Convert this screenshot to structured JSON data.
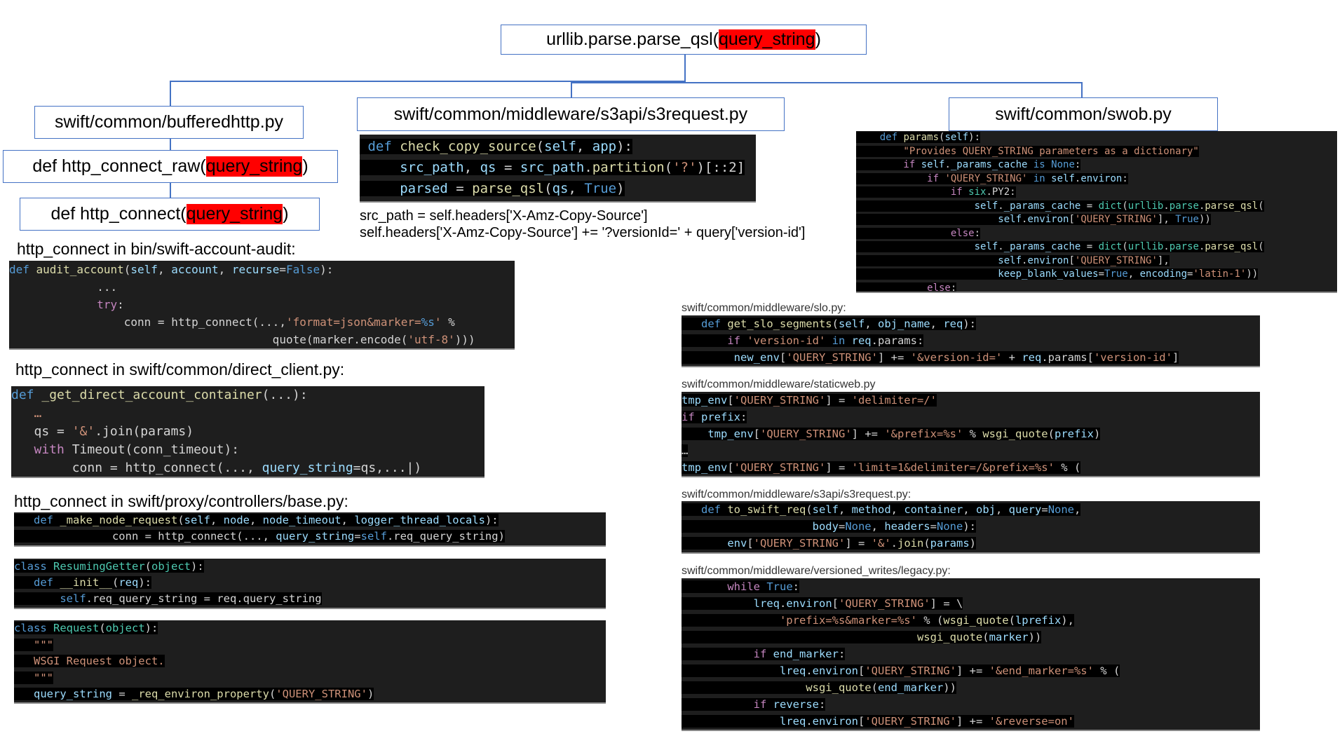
{
  "root": {
    "prefix": "urllib.parse.parse_qsl(",
    "arg": "query_string",
    "suffix": ")"
  },
  "buffered": {
    "title": "swift/common/bufferedhttp.py",
    "raw": {
      "prefix": "def http_connect_raw(",
      "arg": "query_string",
      "suffix": ")"
    },
    "conn": {
      "prefix": "def http_connect(",
      "arg": "query_string",
      "suffix": ")"
    }
  },
  "s3request": {
    "title": "swift/common/middleware/s3api/s3request.py",
    "note1": "src_path = self.headers['X-Amz-Copy-Source']",
    "note2": "self.headers['X-Amz-Copy-Source'] += '?versionId=' + query['version-id']"
  },
  "swob": {
    "title": "swift/common/swob.py"
  },
  "labels": {
    "audit": "http_connect  in bin/swift-account-audit:",
    "direct": "http_connect  in swift/common/direct_client.py:",
    "base": "http_connect in swift/proxy/controllers/base.py:",
    "slo": "swift/common/middleware/slo.py:",
    "staticweb": "swift/common/middleware/staticweb.py",
    "s3req": "swift/common/middleware/s3api/s3request.py:",
    "legacy": "swift/common/middleware/versioned_writes/legacy.py:"
  },
  "code": {
    "s3check": [
      [
        [
          " def ",
          "k"
        ],
        [
          "check_copy_source",
          "f"
        ],
        [
          "(",
          "p"
        ],
        [
          "self",
          "v"
        ],
        [
          ", ",
          "p"
        ],
        [
          "app",
          "v"
        ],
        [
          "):",
          "p"
        ]
      ],
      [
        [
          "     src_path",
          "v"
        ],
        [
          ", ",
          "p"
        ],
        [
          "qs",
          "v"
        ],
        [
          " = ",
          "p"
        ],
        [
          "src_path",
          "v"
        ],
        [
          ".",
          "p"
        ],
        [
          "partition",
          "f"
        ],
        [
          "(",
          "p"
        ],
        [
          "'?'",
          "s"
        ],
        [
          ")[::2]",
          "p"
        ]
      ],
      [
        [
          "     parsed",
          "v"
        ],
        [
          " = ",
          "p"
        ],
        [
          "parse_qsl",
          "f"
        ],
        [
          "(",
          "p"
        ],
        [
          "qs",
          "v"
        ],
        [
          ", ",
          "p"
        ],
        [
          "True",
          "k"
        ],
        [
          ")",
          "p"
        ]
      ]
    ],
    "swob": [
      [
        [
          "    def ",
          "k"
        ],
        [
          "params",
          "f"
        ],
        [
          "(",
          "p"
        ],
        [
          "self",
          "v"
        ],
        [
          "):",
          "p"
        ]
      ],
      [
        [
          "        \"Provides QUERY_STRING parameters as a dictionary\"",
          "s"
        ]
      ],
      [
        [
          "        if ",
          "c"
        ],
        [
          "self",
          "v"
        ],
        [
          ".",
          "p"
        ],
        [
          "_params_cache",
          "v"
        ],
        [
          " is ",
          "k"
        ],
        [
          "None",
          "k"
        ],
        [
          ":",
          "p"
        ]
      ],
      [
        [
          "            if ",
          "c"
        ],
        [
          "'QUERY_STRING'",
          "s"
        ],
        [
          " in ",
          "k"
        ],
        [
          "self",
          "v"
        ],
        [
          ".",
          "p"
        ],
        [
          "environ",
          "v"
        ],
        [
          ":",
          "p"
        ]
      ],
      [
        [
          "                if ",
          "c"
        ],
        [
          "six",
          "t"
        ],
        [
          ".PY2:",
          "p"
        ]
      ],
      [
        [
          "                    self",
          "v"
        ],
        [
          ".",
          "p"
        ],
        [
          "_params_cache",
          "v"
        ],
        [
          " = ",
          "p"
        ],
        [
          "dict",
          "t"
        ],
        [
          "(",
          "p"
        ],
        [
          "urllib",
          "t"
        ],
        [
          ".",
          "p"
        ],
        [
          "parse",
          "t"
        ],
        [
          ".",
          "p"
        ],
        [
          "parse_qsl",
          "f"
        ],
        [
          "(",
          "p"
        ]
      ],
      [
        [
          "                        self",
          "v"
        ],
        [
          ".",
          "p"
        ],
        [
          "environ",
          "v"
        ],
        [
          "[",
          "p"
        ],
        [
          "'QUERY_STRING'",
          "s"
        ],
        [
          "], ",
          "p"
        ],
        [
          "True",
          "k"
        ],
        [
          "))",
          "p"
        ]
      ],
      [
        [
          "                else",
          "c"
        ],
        [
          ":",
          "p"
        ]
      ],
      [
        [
          "                    self",
          "v"
        ],
        [
          ".",
          "p"
        ],
        [
          "_params_cache",
          "v"
        ],
        [
          " = ",
          "p"
        ],
        [
          "dict",
          "t"
        ],
        [
          "(",
          "p"
        ],
        [
          "urllib",
          "t"
        ],
        [
          ".",
          "p"
        ],
        [
          "parse",
          "t"
        ],
        [
          ".",
          "p"
        ],
        [
          "parse_qsl",
          "f"
        ],
        [
          "(",
          "p"
        ]
      ],
      [
        [
          "                        self",
          "v"
        ],
        [
          ".",
          "p"
        ],
        [
          "environ",
          "v"
        ],
        [
          "[",
          "p"
        ],
        [
          "'QUERY_STRING'",
          "s"
        ],
        [
          "],",
          "p"
        ]
      ],
      [
        [
          "                        keep_blank_values",
          "v"
        ],
        [
          "=",
          "p"
        ],
        [
          "True",
          "k"
        ],
        [
          ", ",
          "p"
        ],
        [
          "encoding",
          "v"
        ],
        [
          "=",
          "p"
        ],
        [
          "'latin-1'",
          "s"
        ],
        [
          "))",
          "p"
        ]
      ],
      [
        [
          "            else",
          "c"
        ],
        [
          ":",
          "p"
        ]
      ]
    ],
    "audit": [
      [
        [
          "def ",
          "k"
        ],
        [
          "audit_account",
          "f"
        ],
        [
          "(",
          "p"
        ],
        [
          "self",
          "v"
        ],
        [
          ", ",
          "p"
        ],
        [
          "account",
          "v"
        ],
        [
          ", ",
          "p"
        ],
        [
          "recurse",
          "v"
        ],
        [
          "=",
          "p"
        ],
        [
          "False",
          "k"
        ],
        [
          "):",
          "p"
        ]
      ],
      [
        [
          "             ...",
          "p"
        ]
      ],
      [
        [
          "             try",
          "c"
        ],
        [
          ":",
          "p"
        ]
      ],
      [
        [
          "                 conn = http_connect(...,",
          "p"
        ],
        [
          "'format=json&marker=",
          "s"
        ],
        [
          "%s",
          "k"
        ],
        [
          "'",
          "s"
        ],
        [
          " %",
          "p"
        ]
      ],
      [
        [
          "                                       quote(marker.encode(",
          "p"
        ],
        [
          "'utf-8'",
          "s"
        ],
        [
          ")))",
          "p"
        ]
      ]
    ],
    "direct": [
      [
        [
          "def ",
          "k"
        ],
        [
          "_get_direct_account_container",
          "f"
        ],
        [
          "(...):",
          "p"
        ]
      ],
      [
        [
          "   …",
          "s"
        ]
      ],
      [
        [
          "   qs = ",
          "p"
        ],
        [
          "'&'",
          "s"
        ],
        [
          ".join(params)",
          "p"
        ]
      ],
      [
        [
          "   with ",
          "c"
        ],
        [
          "Timeout(conn_timeout):",
          "p"
        ]
      ],
      [
        [
          "        conn = http_connect(..., ",
          "p"
        ],
        [
          "query_string",
          "v"
        ],
        [
          "=qs,...|)",
          "p"
        ]
      ]
    ],
    "base1": [
      [
        [
          "   def ",
          "k"
        ],
        [
          "_make_node_request",
          "f"
        ],
        [
          "(",
          "p"
        ],
        [
          "self",
          "v"
        ],
        [
          ", ",
          "p"
        ],
        [
          "node",
          "v"
        ],
        [
          ", ",
          "p"
        ],
        [
          "node_timeout",
          "v"
        ],
        [
          ", ",
          "p"
        ],
        [
          "logger_thread_locals",
          "v"
        ],
        [
          "):",
          "p"
        ]
      ],
      [
        [
          "               conn = http_connect(..., ",
          "p"
        ],
        [
          "query_string",
          "v"
        ],
        [
          "=",
          "p"
        ],
        [
          "self",
          "k"
        ],
        [
          ".req_query_string)",
          "p"
        ]
      ]
    ],
    "base2": [
      [
        [
          "class ",
          "k"
        ],
        [
          "ResumingGetter",
          "t"
        ],
        [
          "(",
          "p"
        ],
        [
          "object",
          "t"
        ],
        [
          "):",
          "p"
        ]
      ],
      [
        [
          "   def ",
          "k"
        ],
        [
          "__init__",
          "f"
        ],
        [
          "(",
          "p"
        ],
        [
          "req",
          "v"
        ],
        [
          "):",
          "p"
        ]
      ],
      [
        [
          "       self",
          "k"
        ],
        [
          ".req_query_string = req.query_string",
          "p"
        ]
      ]
    ],
    "base3": [
      [
        [
          "class ",
          "k"
        ],
        [
          "Request",
          "t"
        ],
        [
          "(",
          "p"
        ],
        [
          "object",
          "t"
        ],
        [
          "):",
          "p"
        ]
      ],
      [
        [
          "   \"\"\"",
          "s"
        ]
      ],
      [
        [
          "   WSGI Request object.",
          "s"
        ]
      ],
      [
        [
          "   \"\"\"",
          "s"
        ]
      ],
      [
        [
          "   query_string",
          "v"
        ],
        [
          " = ",
          "p"
        ],
        [
          "_req_environ_property",
          "f"
        ],
        [
          "(",
          "p"
        ],
        [
          "'QUERY_STRING'",
          "s"
        ],
        [
          ")",
          "p"
        ]
      ]
    ],
    "slo": [
      [
        [
          "   def ",
          "k"
        ],
        [
          "get_slo_segments",
          "f"
        ],
        [
          "(",
          "p"
        ],
        [
          "self",
          "v"
        ],
        [
          ", ",
          "p"
        ],
        [
          "obj_name",
          "v"
        ],
        [
          ", ",
          "p"
        ],
        [
          "req",
          "v"
        ],
        [
          "):",
          "p"
        ]
      ],
      [
        [
          "       if ",
          "c"
        ],
        [
          "'version-id'",
          "s"
        ],
        [
          " in ",
          "k"
        ],
        [
          "req",
          "v"
        ],
        [
          ".params:",
          "p"
        ]
      ],
      [
        [
          "        new_env",
          "v"
        ],
        [
          "[",
          "p"
        ],
        [
          "'QUERY_STRING'",
          "s"
        ],
        [
          "] += ",
          "p"
        ],
        [
          "'&version-id='",
          "s"
        ],
        [
          " + ",
          "p"
        ],
        [
          "req",
          "v"
        ],
        [
          ".params[",
          "p"
        ],
        [
          "'version-id'",
          "s"
        ],
        [
          "]",
          "p"
        ]
      ]
    ],
    "staticweb": [
      [
        [
          "tmp_env",
          "v"
        ],
        [
          "[",
          "p"
        ],
        [
          "'QUERY_STRING'",
          "s"
        ],
        [
          "] = ",
          "p"
        ],
        [
          "'delimiter=/'",
          "s"
        ]
      ],
      [
        [
          "if ",
          "c"
        ],
        [
          "prefix",
          "v"
        ],
        [
          ":",
          "p"
        ]
      ],
      [
        [
          "    tmp_env",
          "v"
        ],
        [
          "[",
          "p"
        ],
        [
          "'QUERY_STRING'",
          "s"
        ],
        [
          "] += ",
          "p"
        ],
        [
          "'&prefix=%s'",
          "s"
        ],
        [
          " % ",
          "p"
        ],
        [
          "wsgi_quote",
          "f"
        ],
        [
          "(",
          "p"
        ],
        [
          "prefix",
          "v"
        ],
        [
          ")",
          "p"
        ]
      ],
      [
        [
          "…",
          "p"
        ]
      ],
      [
        [
          "tmp_env",
          "v"
        ],
        [
          "[",
          "p"
        ],
        [
          "'QUERY_STRING'",
          "s"
        ],
        [
          "] = ",
          "p"
        ],
        [
          "'limit=1&delimiter=/&prefix=%s'",
          "s"
        ],
        [
          " % (",
          "p"
        ]
      ]
    ],
    "s3req": [
      [
        [
          "   def ",
          "k"
        ],
        [
          "to_swift_req",
          "f"
        ],
        [
          "(",
          "p"
        ],
        [
          "self",
          "v"
        ],
        [
          ", ",
          "p"
        ],
        [
          "method",
          "v"
        ],
        [
          ", ",
          "p"
        ],
        [
          "container",
          "v"
        ],
        [
          ", ",
          "p"
        ],
        [
          "obj",
          "v"
        ],
        [
          ", ",
          "p"
        ],
        [
          "query",
          "v"
        ],
        [
          "=",
          "p"
        ],
        [
          "None",
          "k"
        ],
        [
          ",",
          "p"
        ]
      ],
      [
        [
          "                    body",
          "v"
        ],
        [
          "=",
          "p"
        ],
        [
          "None",
          "k"
        ],
        [
          ", ",
          "p"
        ],
        [
          "headers",
          "v"
        ],
        [
          "=",
          "p"
        ],
        [
          "None",
          "k"
        ],
        [
          "):",
          "p"
        ]
      ],
      [
        [
          "       env",
          "v"
        ],
        [
          "[",
          "p"
        ],
        [
          "'QUERY_STRING'",
          "s"
        ],
        [
          "] = ",
          "p"
        ],
        [
          "'&'",
          "s"
        ],
        [
          ".",
          "p"
        ],
        [
          "join",
          "f"
        ],
        [
          "(",
          "p"
        ],
        [
          "params",
          "v"
        ],
        [
          ")",
          "p"
        ]
      ]
    ],
    "legacy": [
      [
        [
          "       while ",
          "c"
        ],
        [
          "True",
          "k"
        ],
        [
          ":",
          "p"
        ]
      ],
      [
        [
          "           lreq",
          "v"
        ],
        [
          ".",
          "p"
        ],
        [
          "environ",
          "v"
        ],
        [
          "[",
          "p"
        ],
        [
          "'QUERY_STRING'",
          "s"
        ],
        [
          "] = \\",
          "p"
        ]
      ],
      [
        [
          "               'prefix=%s&marker=%s'",
          "s"
        ],
        [
          " % (",
          "p"
        ],
        [
          "wsgi_quote",
          "f"
        ],
        [
          "(",
          "p"
        ],
        [
          "lprefix",
          "v"
        ],
        [
          "),",
          "p"
        ]
      ],
      [
        [
          "                                    wsgi_quote",
          "f"
        ],
        [
          "(",
          "p"
        ],
        [
          "marker",
          "v"
        ],
        [
          "))",
          "p"
        ]
      ],
      [
        [
          "           if ",
          "c"
        ],
        [
          "end_marker",
          "v"
        ],
        [
          ":",
          "p"
        ]
      ],
      [
        [
          "               lreq",
          "v"
        ],
        [
          ".",
          "p"
        ],
        [
          "environ",
          "v"
        ],
        [
          "[",
          "p"
        ],
        [
          "'QUERY_STRING'",
          "s"
        ],
        [
          "] += ",
          "p"
        ],
        [
          "'&end_marker=%s'",
          "s"
        ],
        [
          " % (",
          "p"
        ]
      ],
      [
        [
          "                   wsgi_quote",
          "f"
        ],
        [
          "(",
          "p"
        ],
        [
          "end_marker",
          "v"
        ],
        [
          "))",
          "p"
        ]
      ],
      [
        [
          "           if ",
          "c"
        ],
        [
          "reverse",
          "v"
        ],
        [
          ":",
          "p"
        ]
      ],
      [
        [
          "               lreq",
          "v"
        ],
        [
          ".",
          "p"
        ],
        [
          "environ",
          "v"
        ],
        [
          "[",
          "p"
        ],
        [
          "'QUERY_STRING'",
          "s"
        ],
        [
          "] += ",
          "p"
        ],
        [
          "'&reverse=on'",
          "s"
        ]
      ]
    ]
  }
}
